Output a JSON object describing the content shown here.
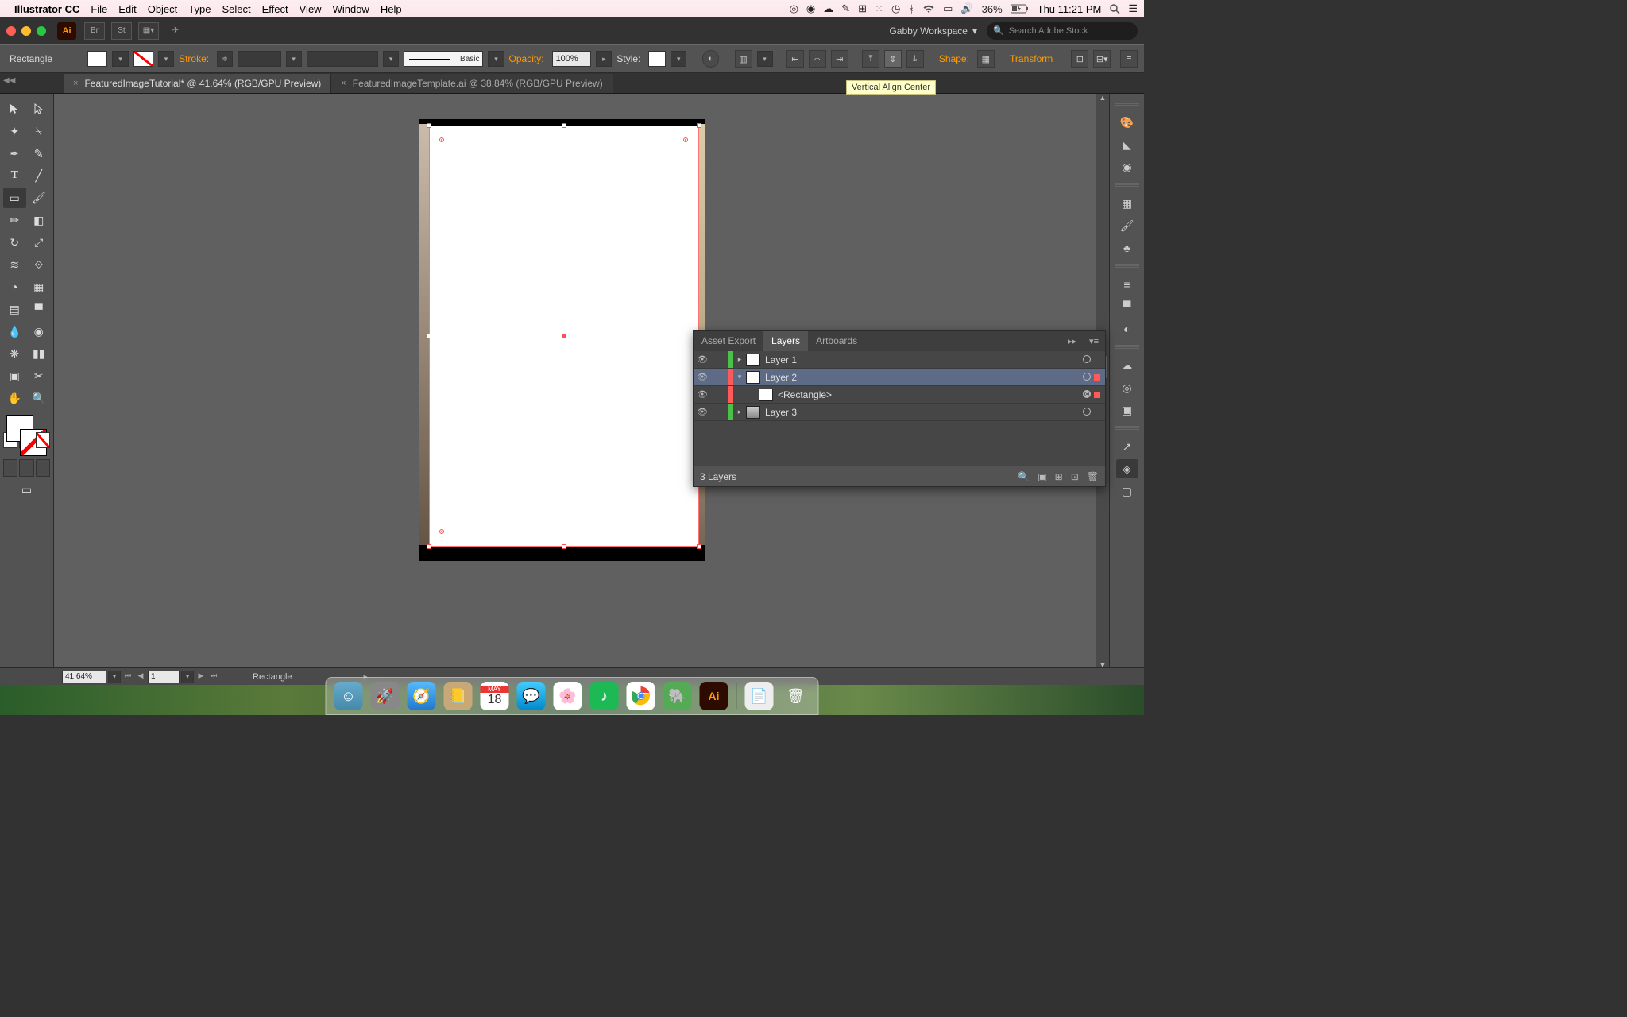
{
  "mac_menu": {
    "app": "Illustrator CC",
    "items": [
      "File",
      "Edit",
      "Object",
      "Type",
      "Select",
      "Effect",
      "View",
      "Window",
      "Help"
    ],
    "battery": "36%",
    "clock": "Thu 11:21 PM"
  },
  "app_top": {
    "workspace": "Gabby Workspace",
    "search_placeholder": "Search Adobe Stock"
  },
  "control": {
    "selection": "Rectangle",
    "stroke_label": "Stroke:",
    "brush_label": "Basic",
    "opacity_label": "Opacity:",
    "opacity_value": "100%",
    "style_label": "Style:",
    "shape_label": "Shape:",
    "transform_label": "Transform"
  },
  "tabs": [
    {
      "title": "FeaturedImageTutorial* @ 41.64% (RGB/GPU Preview)",
      "active": true
    },
    {
      "title": "FeaturedImageTemplate.ai @ 38.84% (RGB/GPU Preview)",
      "active": false
    }
  ],
  "tooltip": "Vertical Align Center",
  "status": {
    "zoom": "41.64%",
    "artboard": "1",
    "tool": "Rectangle"
  },
  "layers_panel": {
    "tabs": [
      "Asset Export",
      "Layers",
      "Artboards"
    ],
    "active_tab": "Layers",
    "rows": [
      {
        "color": "green",
        "name": "Layer 1",
        "expanded": false,
        "selected": false,
        "target": "single",
        "indent": 0
      },
      {
        "color": "red",
        "name": "Layer 2",
        "expanded": true,
        "selected": true,
        "target": "single",
        "selbox": true,
        "indent": 0
      },
      {
        "color": "red",
        "name": "<Rectangle>",
        "expanded": null,
        "selected": false,
        "target": "double",
        "selbox": true,
        "indent": 1
      },
      {
        "color": "green",
        "name": "Layer 3",
        "expanded": false,
        "selected": false,
        "target": "single",
        "indent": 0,
        "thumb": "img"
      }
    ],
    "footer_count": "3 Layers"
  },
  "dock": {
    "calendar_day": "18",
    "calendar_month": "MAY"
  }
}
